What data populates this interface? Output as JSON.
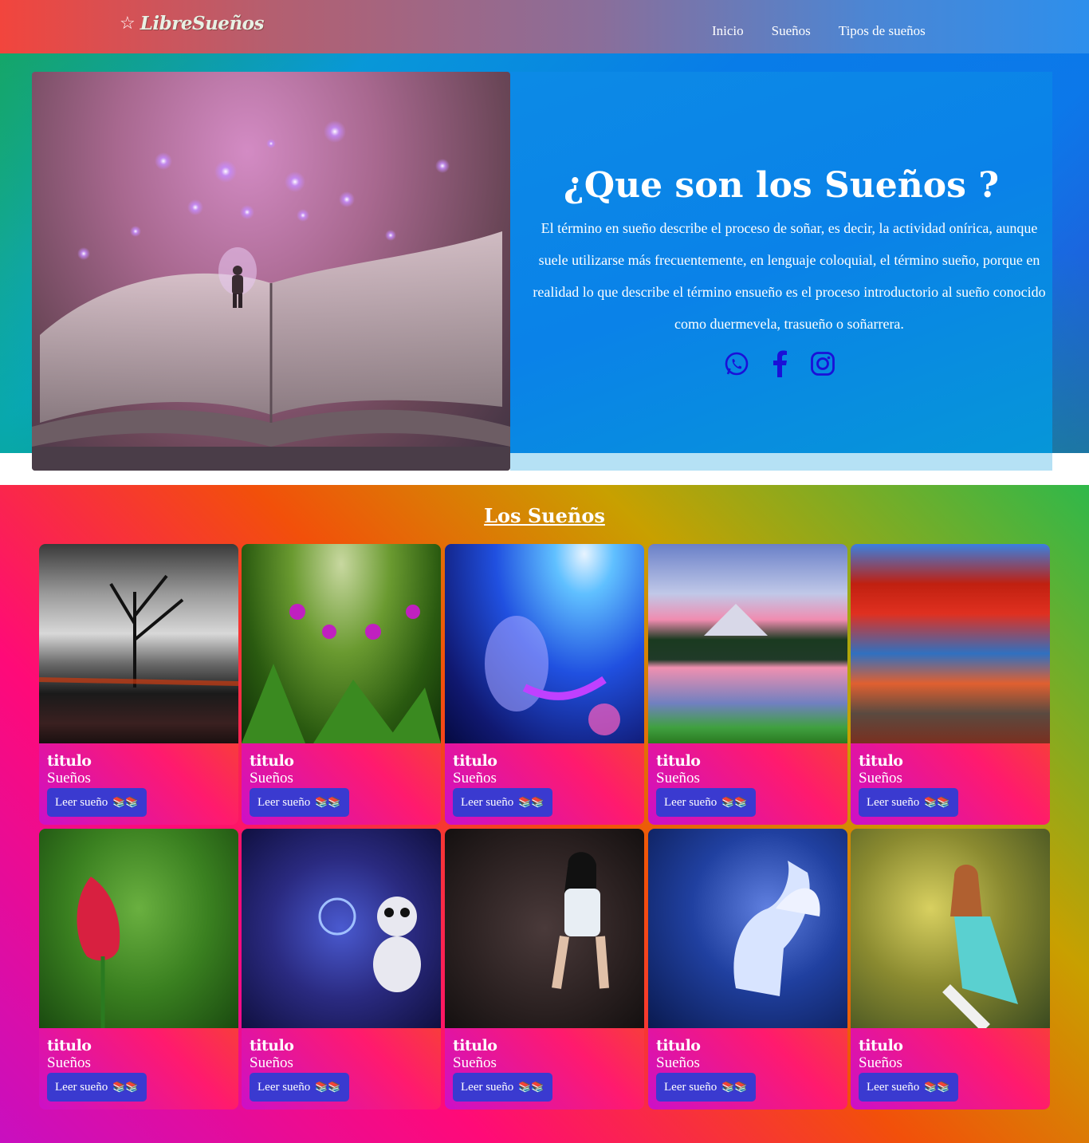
{
  "nav": {
    "brand_icon": "star-icon",
    "brand_name": "LibreSueños",
    "links": [
      "Inicio",
      "Sueños",
      "Tipos de sueños"
    ]
  },
  "hero": {
    "title": "¿Que son los Sueños ?",
    "text": "El término en sueño describe el proceso de soñar,  es decir, la actividad onírica, aunque suele utilizarse más frecuentemente, en lenguaje coloquial, el término sueño, porque en realidad lo que describe el término ensueño es el proceso introductorio al sueño conocido como duermevela, trasueño o soñarrera.",
    "socials": [
      "whatsapp-icon",
      "facebook-icon",
      "instagram-icon"
    ],
    "icon_color": "#1a10d8"
  },
  "dreams": {
    "title": "Los Sueños",
    "cards": [
      {
        "title": "titulo",
        "subtitle": "Sueños",
        "button": "Leer sueño",
        "image": "dark-sunset-trees"
      },
      {
        "title": "titulo",
        "subtitle": "Sueños",
        "button": "Leer sueño",
        "image": "green-ferns-flowers"
      },
      {
        "title": "titulo",
        "subtitle": "Sueños",
        "button": "Leer sueño",
        "image": "mermaid-underwater"
      },
      {
        "title": "titulo",
        "subtitle": "Sueños",
        "button": "Leer sueño",
        "image": "mountain-lake"
      },
      {
        "title": "titulo",
        "subtitle": "Sueños",
        "button": "Leer sueño",
        "image": "autumn-lake"
      },
      {
        "title": "titulo",
        "subtitle": "Sueños",
        "button": "Leer sueño",
        "image": "red-tulip"
      },
      {
        "title": "titulo",
        "subtitle": "Sueños",
        "button": "Leer sueño",
        "image": "panda-bubbles"
      },
      {
        "title": "titulo",
        "subtitle": "Sueños",
        "button": "Leer sueño",
        "image": "girl-kneeling"
      },
      {
        "title": "titulo",
        "subtitle": "Sueños",
        "button": "Leer sueño",
        "image": "pegasus-forest"
      },
      {
        "title": "titulo",
        "subtitle": "Sueños",
        "button": "Leer sueño",
        "image": "girl-on-tree"
      }
    ]
  }
}
